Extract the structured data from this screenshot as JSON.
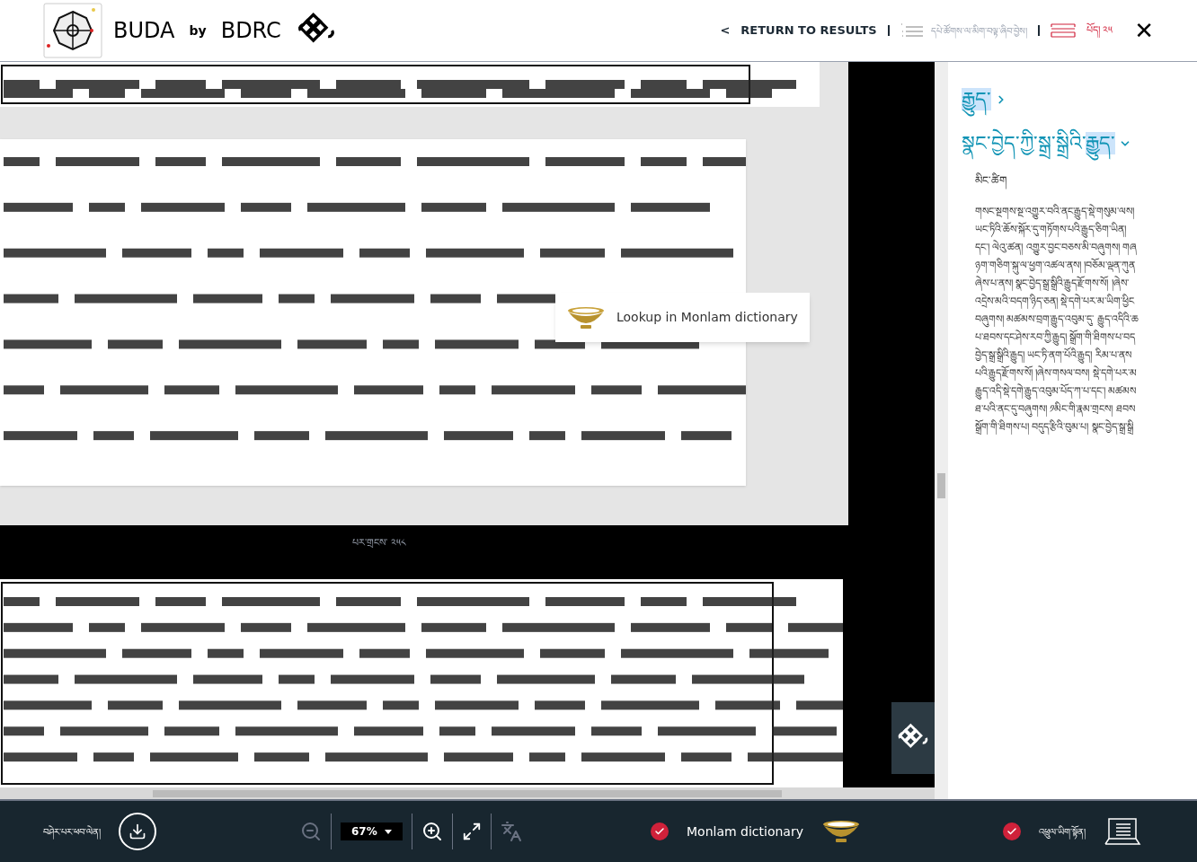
{
  "header": {
    "brand": "BUDA",
    "by": "by",
    "org": "BDRC",
    "back_caret": "<",
    "back_label": "RETURN TO RESULTS",
    "outline_label": "དཔེ་ཚོགས་ལ་མིག་བལྟ་ཞིབ་བྱེས།",
    "volume_label": "པོད། ༢༥",
    "close": "✕"
  },
  "viewer": {
    "page_caption": "པར་གྲངས་ ༢༥༨",
    "popup": {
      "label": "Lookup in Monlam dictionary"
    }
  },
  "panel": {
    "headings": [
      {
        "expanded": false,
        "parts": [
          {
            "text": "རྒྱུད་",
            "highlighted": true
          }
        ]
      },
      {
        "expanded": true,
        "parts": [
          {
            "text": "སྣང་བྱེད་ཀྱི་སྒྲ་སྒྲིའི་",
            "highlighted": false
          },
          {
            "text": "རྒྱུད་",
            "highlighted": true
          }
        ]
      }
    ],
    "subheading": "མིང་ཚིག",
    "lines": [
      "གསང་སྔགས་སྔ་འགྱུར་བའི་ནང་རྒྱུད་སྡེ་གསུམ་ལས།",
      "ཡང་ཏིའི་ཆོས་སྐོར་དུ་གཏོགས་པའི་རྒྱུད་ཅིག་ཡིན།",
      "དང་། ལེའུ་ཚན། འགྱུར་བྱང་བཅས་མི་བཞུགས། གཞ",
      "ཉག་གཅིག་སྐུ་ལ་ཕྱག་འཚལ་ནས། །བཅོམ་ལྡན་ཀུན",
      "ཞེས་པ་ནས། སྣང་བྱེད་སྒྲ་སྒྲིའི་རྒྱུད་རྫོགས་སོ། །ཞེས་",
      "འདྲེས་མའི་བདག་ཉིད་ཅན། སྡེ་དགེ་པར་མ་ཡིག་ཕྱིང",
      "བཞུགས། མཚམས་བྲག་རྒྱུད་འབུམ་དུ་ རྒྱུད་འདིའི་ཆ",
      "པ་ཐབས་དང་ཤེས་རབ་ཀྱི་རྒྱུད། སྒྲོག་གི་ཐིགས་པ་བད",
      "བྱེད་སྒྲ་སྒྲིའི་རྒྱུད། ཡང་ཏི་ནག་པོའི་རྒྱུད། རིམ་པ་ནས",
      "པའི་རྒྱུད་རྫོགས་སོ། །ཞེས་གསལ་བས། སྡེ་དགེ་པར་མ",
      "རྒྱུད་འདི་སྡེ་དགེ་རྒྱུད་འབུམ་པོད་ཀ་པ་དང་། མཚམས",
      "ཐ་པའི་ནང་དུ་བཞུགས། ༡མིང་གི་རྣམ་གྲངས། ཐབས",
      "སྒྲོག་གི་ཐིགས་པ། བདུད་རྩིའི་བུམ་པ། སྣང་བྱེད་སྒྲ་སྒྲི"
    ]
  },
  "toolbar": {
    "download_label": "བཤེར་པར་ཕབ་ལེན།",
    "zoom": "67%",
    "zoom_out_disabled": true,
    "translate_disabled": true,
    "toggles": [
      {
        "label": "Monlam dictionary",
        "checked": true,
        "kind": "bowl"
      },
      {
        "label": "འཕྲུལ་ཡིག་སྟོན།",
        "checked": true,
        "kind": "laptop"
      }
    ]
  }
}
